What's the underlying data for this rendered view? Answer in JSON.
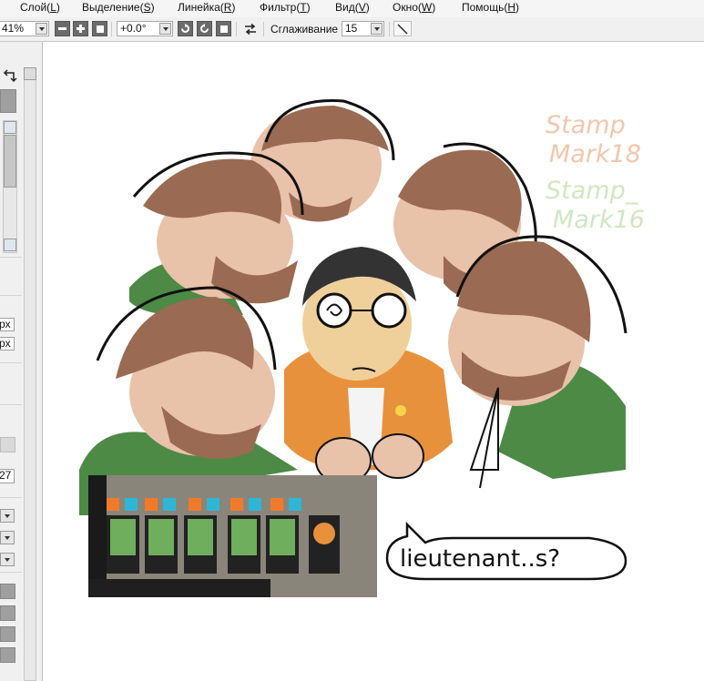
{
  "menu": {
    "layer": {
      "text": "Слой(",
      "key": "L",
      "end": ")"
    },
    "select": {
      "text": "Выделение(",
      "key": "S",
      "end": ")"
    },
    "ruler": {
      "text": "Линейка(",
      "key": "R",
      "end": ")"
    },
    "filter": {
      "text": "Фильтр(",
      "key": "T",
      "end": ")"
    },
    "view": {
      "text": "Вид(",
      "key": "V",
      "end": ")"
    },
    "window": {
      "text": "Окно(",
      "key": "W",
      "end": ")"
    },
    "help": {
      "text": "Помощь(",
      "key": "H",
      "end": ")"
    }
  },
  "toolbar": {
    "zoom": "41%",
    "rotation": "+0.0°",
    "smoothing_label": "Сглаживание",
    "smoothing_value": "15"
  },
  "left_panel": {
    "px_label_1": "px",
    "px_label_2": "px",
    "number_value": "27"
  },
  "artwork": {
    "watermark_1_line_1": "Stamp",
    "watermark_1_line_2": "Mark18",
    "watermark_2_line_1": "Stamp_",
    "watermark_2_line_2": "Mark16",
    "speech_text": "lieutenant..s?"
  },
  "colors": {
    "hair_brown": "#9a6a52",
    "skin": "#e9c2aa",
    "green": "#4c8a45",
    "orange": "#e8913c",
    "watermark_peach": "#f2c7ad",
    "watermark_green": "#cfe8c0"
  }
}
